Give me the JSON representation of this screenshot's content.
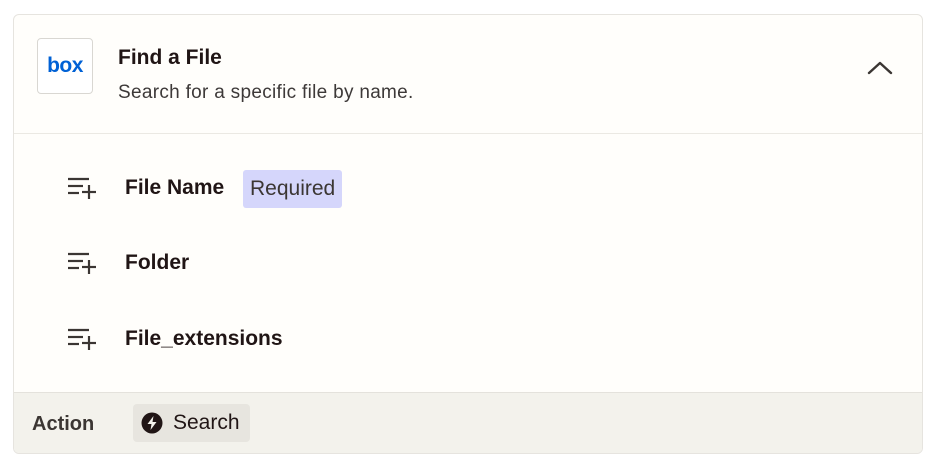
{
  "step": {
    "app_logo_text": "box",
    "title": "Find a File",
    "subtitle": "Search for a specific file by name.",
    "collapse_icon": "chevron-up-icon"
  },
  "fields": [
    {
      "label": "File Name",
      "badge": "Required",
      "icon": "list-add-icon"
    },
    {
      "label": "Folder",
      "icon": "list-add-icon"
    },
    {
      "label": "File_extensions",
      "icon": "list-add-icon"
    }
  ],
  "footer": {
    "label": "Action",
    "action_icon": "bolt-icon",
    "action_text": "Search"
  },
  "colors": {
    "brand_box": "#0061d5",
    "required_badge": "#d5d6fb",
    "footer_bg": "#f3f2ec",
    "text_dark": "#201515"
  }
}
